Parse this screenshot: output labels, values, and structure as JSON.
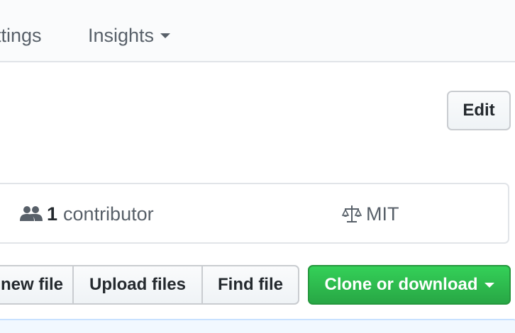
{
  "nav": {
    "tabs": [
      {
        "label": "ttings"
      },
      {
        "label": "Insights"
      }
    ]
  },
  "edit_button": {
    "label": "Edit"
  },
  "summary": {
    "contributors_count": "1",
    "contributors_label": "contributor",
    "license": "MIT"
  },
  "file_actions": {
    "new_file": "new file",
    "upload_files": "Upload files",
    "find_file": "Find file"
  },
  "clone_button": {
    "label": "Clone or download"
  },
  "colors": {
    "primary_green": "#28a745",
    "nav_text": "#586069",
    "border": "#e1e4e8"
  },
  "icons": {
    "contributors": "people-icon",
    "license": "law-icon",
    "insights_dropdown": "caret-down-icon",
    "clone_dropdown": "caret-down-icon"
  }
}
